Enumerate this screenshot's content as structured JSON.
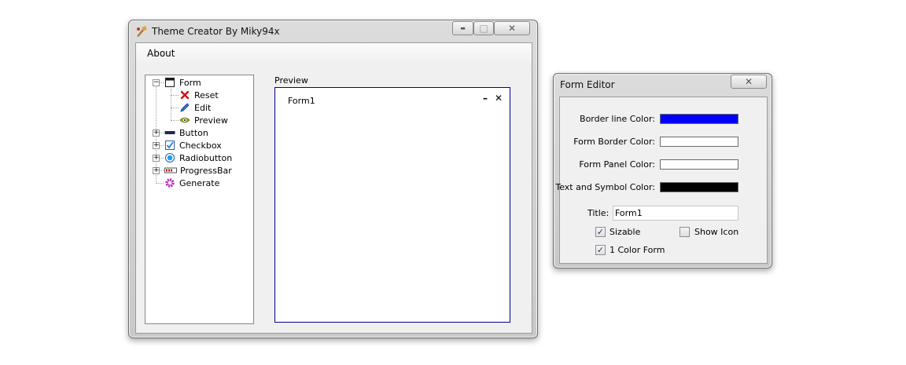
{
  "main_window": {
    "title": "Theme Creator By Miky94x",
    "min_glyph": "▬",
    "max_glyph": "□",
    "close_glyph": "✕",
    "menu": [
      "About"
    ],
    "tree": {
      "form": "Form",
      "reset": "Reset",
      "edit": "Edit",
      "preview": "Preview",
      "button": "Button",
      "checkbox": "Checkbox",
      "radiobutton": "Radiobutton",
      "progressbar": "ProgressBar",
      "generate": "Generate",
      "expanded_glyph": "−",
      "collapsed_glyph": "+"
    },
    "preview": {
      "label": "Preview",
      "form_title": "Form1",
      "min_glyph": "–",
      "close_glyph": "✕",
      "border_color": "#00008b"
    }
  },
  "form_editor": {
    "title": "Form Editor",
    "close_glyph": "✕",
    "border_line_color_label": "Border line Color:",
    "border_line_color": "#0000ff",
    "form_border_color_label": "Form Border Color:",
    "form_border_color": "#ffffff",
    "form_panel_color_label": "Form Panel Color:",
    "form_panel_color": "#ffffff",
    "text_symbol_color_label": "Text and Symbol Color:",
    "text_symbol_color": "#000000",
    "title_label": "Title:",
    "title_value": "Form1",
    "sizable_label": "Sizable",
    "sizable_checked": true,
    "show_icon_label": "Show Icon",
    "show_icon_checked": false,
    "one_color_form_label": "1 Color Form",
    "one_color_form_checked": true,
    "check_glyph": "✓"
  }
}
